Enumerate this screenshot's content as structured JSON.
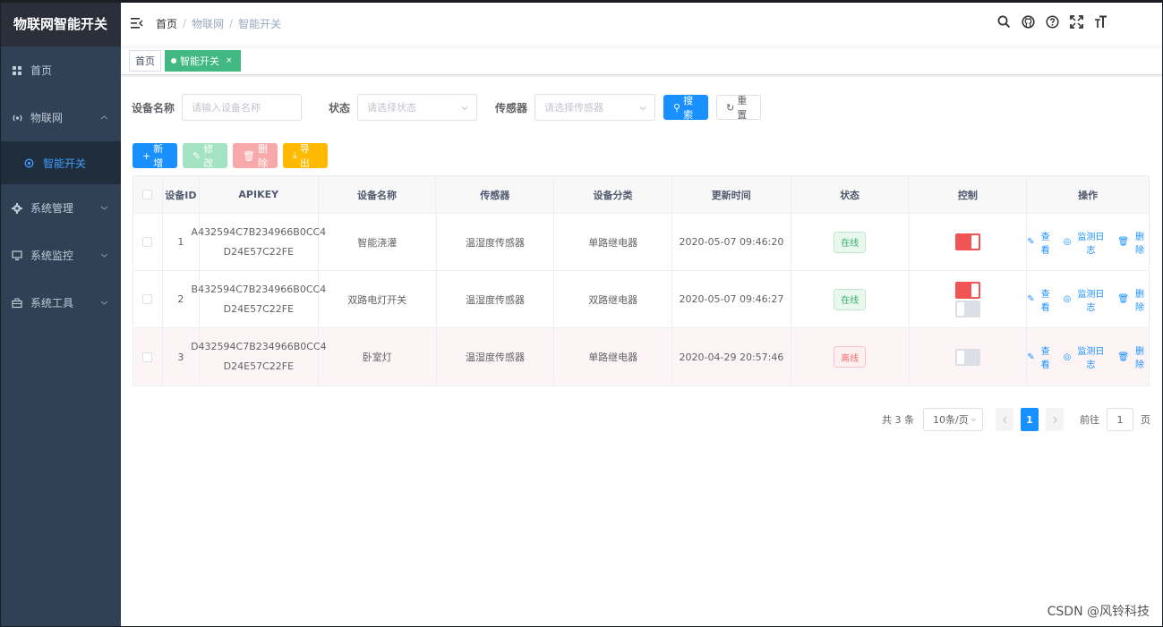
{
  "app": {
    "title": "物联网智能开关"
  },
  "sidebar": {
    "items": [
      {
        "label": "首页",
        "icon": "dashboard-icon"
      },
      {
        "label": "物联网",
        "icon": "iot-icon",
        "expanded": true,
        "children": [
          {
            "label": "智能开关",
            "icon": "switch-icon",
            "active": true
          }
        ]
      },
      {
        "label": "系统管理",
        "icon": "gear-icon"
      },
      {
        "label": "系统监控",
        "icon": "monitor-icon"
      },
      {
        "label": "系统工具",
        "icon": "toolbox-icon"
      }
    ]
  },
  "navbar": {
    "breadcrumb": [
      "首页",
      "物联网",
      "智能开关"
    ],
    "icons": [
      "search-icon",
      "github-icon",
      "help-icon",
      "fullscreen-icon",
      "font-size-icon"
    ]
  },
  "tags": [
    {
      "label": "首页",
      "active": false
    },
    {
      "label": "智能开关",
      "active": true,
      "close": "×"
    }
  ],
  "search": {
    "name_label": "设备名称",
    "name_placeholder": "请输入设备名称",
    "status_label": "状态",
    "status_placeholder": "请选择状态",
    "sensor_label": "传感器",
    "sensor_placeholder": "请选择传感器",
    "search_btn": "搜索",
    "reset_btn": "重置"
  },
  "toolbar": {
    "add": "新增",
    "edit": "修改",
    "delete": "删除",
    "export": "导出"
  },
  "table": {
    "headers": [
      "设备ID",
      "APIKEY",
      "设备名称",
      "传感器",
      "设备分类",
      "更新时间",
      "状态",
      "控制",
      "操作"
    ],
    "rows": [
      {
        "id": "1",
        "apikey_1": "A432594C7B234966B0CC4",
        "apikey_2": "D24E57C22FE",
        "name": "智能浇灌",
        "sensor": "温湿度传感器",
        "category": "单路继电器",
        "updated": "2020-05-07 09:46:20",
        "status": "在线",
        "online": true,
        "switches": [
          true
        ]
      },
      {
        "id": "2",
        "apikey_1": "B432594C7B234966B0CC4",
        "apikey_2": "D24E57C22FE",
        "name": "双路电灯开关",
        "sensor": "温湿度传感器",
        "category": "双路继电器",
        "updated": "2020-05-07 09:46:27",
        "status": "在线",
        "online": true,
        "switches": [
          true,
          false
        ]
      },
      {
        "id": "3",
        "apikey_1": "D432594C7B234966B0CC4",
        "apikey_2": "D24E57C22FE",
        "name": "卧室灯",
        "sensor": "温湿度传感器",
        "category": "单路继电器",
        "updated": "2020-04-29 20:57:46",
        "status": "离线",
        "online": false,
        "switches": [
          false
        ]
      }
    ],
    "ops": {
      "view": "查看",
      "log": "监测日志",
      "delete": "删除"
    }
  },
  "pagination": {
    "total": "共 3 条",
    "page_size": "10条/页",
    "current": "1",
    "goto_label": "前往",
    "goto_value": "1",
    "page_unit": "页"
  },
  "watermark": "CSDN @风铃科技",
  "colors": {
    "sidebar": "#304156",
    "primary": "#1890ff",
    "success": "#42b983",
    "danger": "#f05454"
  }
}
